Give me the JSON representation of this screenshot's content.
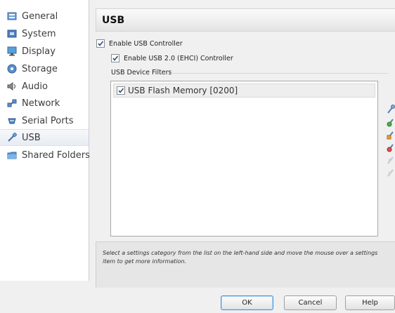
{
  "sidebar": {
    "items": [
      {
        "label": "General",
        "icon": "general-icon"
      },
      {
        "label": "System",
        "icon": "system-icon"
      },
      {
        "label": "Display",
        "icon": "display-icon"
      },
      {
        "label": "Storage",
        "icon": "storage-icon"
      },
      {
        "label": "Audio",
        "icon": "audio-icon"
      },
      {
        "label": "Network",
        "icon": "network-icon"
      },
      {
        "label": "Serial Ports",
        "icon": "serial-ports-icon"
      },
      {
        "label": "USB",
        "icon": "usb-icon",
        "selected": true
      },
      {
        "label": "Shared Folders",
        "icon": "shared-folders-icon"
      }
    ]
  },
  "page": {
    "title": "USB"
  },
  "usb": {
    "enable_controller_label": "Enable USB Controller",
    "enable_controller_checked": true,
    "enable_usb2_label": "Enable USB 2.0 (EHCI) Controller",
    "enable_usb2_checked": true,
    "filters_group_label": "USB Device Filters",
    "filters": [
      {
        "label": "USB Flash Memory [0200]",
        "checked": true
      }
    ],
    "toolbar_icons": [
      "add-filter-icon",
      "add-from-device-icon",
      "edit-filter-icon",
      "remove-filter-icon",
      "move-up-icon",
      "move-down-icon"
    ]
  },
  "info": {
    "text": "Select a settings category from the list on the left-hand side and move the mouse over a settings item to get more information."
  },
  "buttons": {
    "ok": "OK",
    "cancel": "Cancel",
    "help": "Help"
  },
  "colors": {
    "accent": "#4a8fd1",
    "selection": "#e7ecf3",
    "window_background": "#f0f0f0"
  }
}
